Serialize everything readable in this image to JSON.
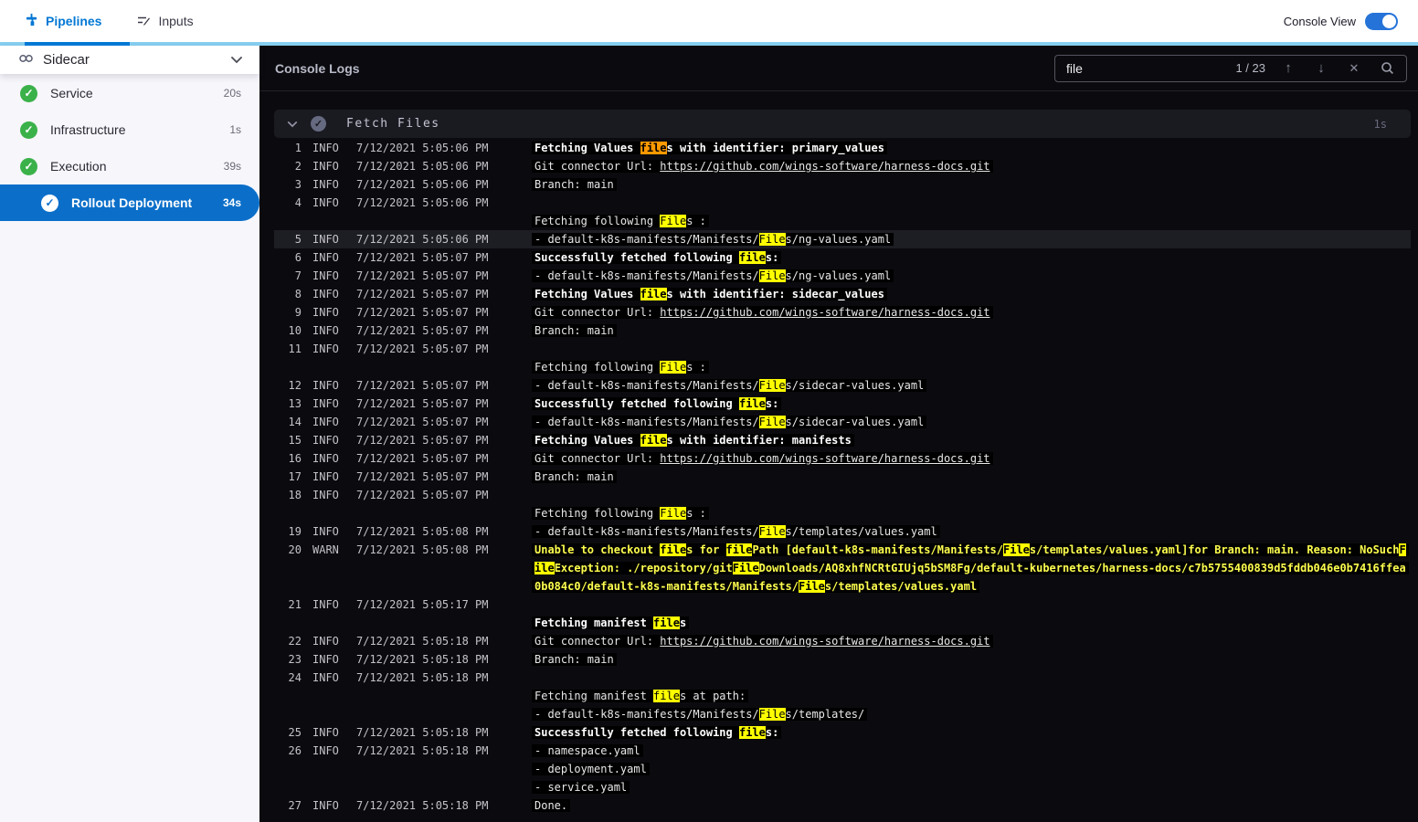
{
  "colors": {
    "accent_blue": "#0278d5",
    "strip_blue": "#87cff0",
    "toggle_blue": "#2573d8",
    "selected_blue": "#0b6fc9",
    "success_green": "#3bb14a",
    "warn_yellow": "#fdfd4e",
    "match_yellow": "#ffff00",
    "current_match_orange": "#ff9900"
  },
  "header": {
    "tabs": [
      {
        "label": "Pipelines"
      },
      {
        "label": "Inputs"
      }
    ],
    "console_view_label": "Console View",
    "console_view_on": true
  },
  "sidebar": {
    "title": "Sidecar",
    "items": [
      {
        "label": "Service",
        "duration": "20s",
        "status": "success",
        "selected": false
      },
      {
        "label": "Infrastructure",
        "duration": "1s",
        "status": "success",
        "selected": false
      },
      {
        "label": "Execution",
        "duration": "39s",
        "status": "success",
        "selected": false
      },
      {
        "label": "Rollout Deployment",
        "duration": "34s",
        "status": "success",
        "selected": true
      }
    ]
  },
  "console": {
    "title": "Console Logs",
    "search": {
      "value": "file",
      "counter": "1 / 23"
    },
    "section": {
      "title": "Fetch Files",
      "duration": "1s"
    },
    "logs": [
      {
        "n": "1",
        "level": "INFO",
        "time": "7/12/2021 5:05:06 PM",
        "lines": [
          {
            "b": 1,
            "segs": [
              [
                "Fetching Values ",
                "t"
              ],
              [
                "file",
                "c"
              ],
              [
                "s with identifier: primary_values",
                "t"
              ]
            ]
          }
        ]
      },
      {
        "n": "2",
        "level": "INFO",
        "time": "7/12/2021 5:05:06 PM",
        "lines": [
          {
            "segs": [
              [
                "Git connector Url: ",
                "t"
              ],
              [
                "https://github.com/wings-software/harness-docs.git",
                "l"
              ]
            ]
          }
        ]
      },
      {
        "n": "3",
        "level": "INFO",
        "time": "7/12/2021 5:05:06 PM",
        "lines": [
          {
            "segs": [
              [
                "Branch: main",
                "t"
              ]
            ]
          }
        ]
      },
      {
        "n": "4",
        "level": "INFO",
        "time": "7/12/2021 5:05:06 PM",
        "lines": [
          {
            "segs": []
          },
          {
            "segs": [
              [
                "Fetching following ",
                "t"
              ],
              [
                "File",
                "m"
              ],
              [
                "s :",
                "t"
              ]
            ]
          }
        ]
      },
      {
        "n": "5",
        "level": "INFO",
        "time": "7/12/2021 5:05:06 PM",
        "hl": 1,
        "lines": [
          {
            "segs": [
              [
                "- default-k8s-manifests/Manifests/",
                "t"
              ],
              [
                "File",
                "m"
              ],
              [
                "s/ng-values.yaml",
                "t"
              ]
            ]
          }
        ]
      },
      {
        "n": "6",
        "level": "INFO",
        "time": "7/12/2021 5:05:07 PM",
        "lines": [
          {
            "b": 1,
            "segs": [
              [
                "Successfully fetched following ",
                "t"
              ],
              [
                "file",
                "m"
              ],
              [
                "s:",
                "t"
              ]
            ]
          }
        ]
      },
      {
        "n": "7",
        "level": "INFO",
        "time": "7/12/2021 5:05:07 PM",
        "lines": [
          {
            "segs": [
              [
                "- default-k8s-manifests/Manifests/",
                "t"
              ],
              [
                "File",
                "m"
              ],
              [
                "s/ng-values.yaml",
                "t"
              ]
            ]
          }
        ]
      },
      {
        "n": "8",
        "level": "INFO",
        "time": "7/12/2021 5:05:07 PM",
        "lines": [
          {
            "b": 1,
            "segs": [
              [
                "Fetching Values ",
                "t"
              ],
              [
                "file",
                "m"
              ],
              [
                "s with identifier: sidecar_values",
                "t"
              ]
            ]
          }
        ]
      },
      {
        "n": "9",
        "level": "INFO",
        "time": "7/12/2021 5:05:07 PM",
        "lines": [
          {
            "segs": [
              [
                "Git connector Url: ",
                "t"
              ],
              [
                "https://github.com/wings-software/harness-docs.git",
                "l"
              ]
            ]
          }
        ]
      },
      {
        "n": "10",
        "level": "INFO",
        "time": "7/12/2021 5:05:07 PM",
        "lines": [
          {
            "segs": [
              [
                "Branch: main",
                "t"
              ]
            ]
          }
        ]
      },
      {
        "n": "11",
        "level": "INFO",
        "time": "7/12/2021 5:05:07 PM",
        "lines": [
          {
            "segs": []
          },
          {
            "segs": [
              [
                "Fetching following ",
                "t"
              ],
              [
                "File",
                "m"
              ],
              [
                "s :",
                "t"
              ]
            ]
          }
        ]
      },
      {
        "n": "12",
        "level": "INFO",
        "time": "7/12/2021 5:05:07 PM",
        "lines": [
          {
            "segs": [
              [
                "- default-k8s-manifests/Manifests/",
                "t"
              ],
              [
                "File",
                "m"
              ],
              [
                "s/sidecar-values.yaml",
                "t"
              ]
            ]
          }
        ]
      },
      {
        "n": "13",
        "level": "INFO",
        "time": "7/12/2021 5:05:07 PM",
        "lines": [
          {
            "b": 1,
            "segs": [
              [
                "Successfully fetched following ",
                "t"
              ],
              [
                "file",
                "m"
              ],
              [
                "s:",
                "t"
              ]
            ]
          }
        ]
      },
      {
        "n": "14",
        "level": "INFO",
        "time": "7/12/2021 5:05:07 PM",
        "lines": [
          {
            "segs": [
              [
                "- default-k8s-manifests/Manifests/",
                "t"
              ],
              [
                "File",
                "m"
              ],
              [
                "s/sidecar-values.yaml",
                "t"
              ]
            ]
          }
        ]
      },
      {
        "n": "15",
        "level": "INFO",
        "time": "7/12/2021 5:05:07 PM",
        "lines": [
          {
            "b": 1,
            "segs": [
              [
                "Fetching Values ",
                "t"
              ],
              [
                "file",
                "m"
              ],
              [
                "s with identifier: manifests",
                "t"
              ]
            ]
          }
        ]
      },
      {
        "n": "16",
        "level": "INFO",
        "time": "7/12/2021 5:05:07 PM",
        "lines": [
          {
            "segs": [
              [
                "Git connector Url: ",
                "t"
              ],
              [
                "https://github.com/wings-software/harness-docs.git",
                "l"
              ]
            ]
          }
        ]
      },
      {
        "n": "17",
        "level": "INFO",
        "time": "7/12/2021 5:05:07 PM",
        "lines": [
          {
            "segs": [
              [
                "Branch: main",
                "t"
              ]
            ]
          }
        ]
      },
      {
        "n": "18",
        "level": "INFO",
        "time": "7/12/2021 5:05:07 PM",
        "lines": [
          {
            "segs": []
          },
          {
            "segs": [
              [
                "Fetching following ",
                "t"
              ],
              [
                "File",
                "m"
              ],
              [
                "s :",
                "t"
              ]
            ]
          }
        ]
      },
      {
        "n": "19",
        "level": "INFO",
        "time": "7/12/2021 5:05:08 PM",
        "lines": [
          {
            "segs": [
              [
                "- default-k8s-manifests/Manifests/",
                "t"
              ],
              [
                "File",
                "m"
              ],
              [
                "s/templates/values.yaml",
                "t"
              ]
            ]
          }
        ]
      },
      {
        "n": "20",
        "level": "WARN",
        "time": "7/12/2021 5:05:08 PM",
        "lines": [
          {
            "b": 1,
            "w": 1,
            "segs": [
              [
                "Unable to checkout ",
                "t"
              ],
              [
                "file",
                "m"
              ],
              [
                "s for ",
                "t"
              ],
              [
                "file",
                "m"
              ],
              [
                "Path [default-k8s-manifests/Manifests/",
                "t"
              ],
              [
                "File",
                "m"
              ],
              [
                "s/templates/values.yaml]for Branch: main. Reason: NoSuch",
                "t"
              ],
              [
                "F",
                "m"
              ]
            ]
          },
          {
            "b": 1,
            "w": 1,
            "segs": [
              [
                "ile",
                "m"
              ],
              [
                "Exception: ./repository/git",
                "t"
              ],
              [
                "File",
                "m"
              ],
              [
                "Downloads/AQ8xhfNCRtGIUjq5bSM8Fg/default-kubernetes/harness-docs/c7b5755400839d5fddb046e0b7416ffea",
                "t"
              ]
            ]
          },
          {
            "b": 1,
            "w": 1,
            "segs": [
              [
                "0b084c0/default-k8s-manifests/Manifests/",
                "t"
              ],
              [
                "File",
                "m"
              ],
              [
                "s/templates/values.yaml",
                "t"
              ]
            ]
          }
        ]
      },
      {
        "n": "21",
        "level": "INFO",
        "time": "7/12/2021 5:05:17 PM",
        "lines": [
          {
            "segs": []
          },
          {
            "b": 1,
            "segs": [
              [
                "Fetching manifest ",
                "t"
              ],
              [
                "file",
                "m"
              ],
              [
                "s",
                "t"
              ]
            ]
          }
        ]
      },
      {
        "n": "22",
        "level": "INFO",
        "time": "7/12/2021 5:05:18 PM",
        "lines": [
          {
            "segs": [
              [
                "Git connector Url: ",
                "t"
              ],
              [
                "https://github.com/wings-software/harness-docs.git",
                "l"
              ]
            ]
          }
        ]
      },
      {
        "n": "23",
        "level": "INFO",
        "time": "7/12/2021 5:05:18 PM",
        "lines": [
          {
            "segs": [
              [
                "Branch: main",
                "t"
              ]
            ]
          }
        ]
      },
      {
        "n": "24",
        "level": "INFO",
        "time": "7/12/2021 5:05:18 PM",
        "lines": [
          {
            "segs": []
          },
          {
            "segs": [
              [
                "Fetching manifest ",
                "t"
              ],
              [
                "file",
                "m"
              ],
              [
                "s at path:",
                "t"
              ]
            ]
          },
          {
            "segs": [
              [
                "- default-k8s-manifests/Manifests/",
                "t"
              ],
              [
                "File",
                "m"
              ],
              [
                "s/templates/",
                "t"
              ]
            ]
          }
        ]
      },
      {
        "n": "25",
        "level": "INFO",
        "time": "7/12/2021 5:05:18 PM",
        "lines": [
          {
            "b": 1,
            "segs": [
              [
                "Successfully fetched following ",
                "t"
              ],
              [
                "file",
                "m"
              ],
              [
                "s:",
                "t"
              ]
            ]
          }
        ]
      },
      {
        "n": "26",
        "level": "INFO",
        "time": "7/12/2021 5:05:18 PM",
        "lines": [
          {
            "segs": [
              [
                "- namespace.yaml",
                "t"
              ]
            ]
          },
          {
            "segs": [
              [
                "- deployment.yaml",
                "t"
              ]
            ]
          },
          {
            "segs": [
              [
                "- service.yaml",
                "t"
              ]
            ]
          }
        ]
      },
      {
        "n": "27",
        "level": "INFO",
        "time": "7/12/2021 5:05:18 PM",
        "lines": [
          {
            "segs": [
              [
                "Done.",
                "t"
              ]
            ]
          }
        ]
      }
    ]
  }
}
